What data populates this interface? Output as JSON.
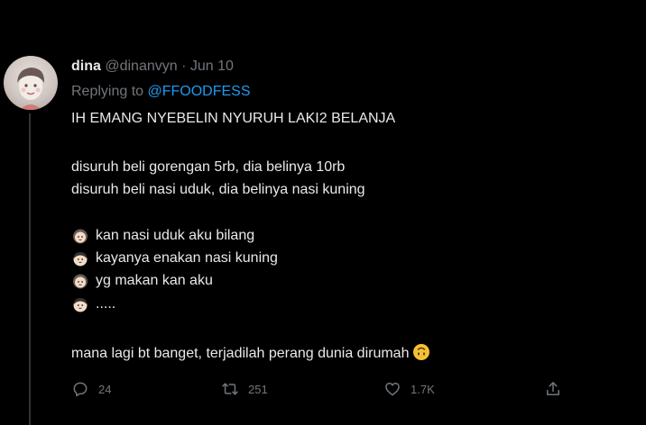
{
  "tweet": {
    "author": {
      "display_name": "dina",
      "handle": "@dinanvyn",
      "separator": "·",
      "date": "Jun 10"
    },
    "replying_to": {
      "prefix": "Replying to",
      "mention": "@FFOODFESS"
    },
    "text": {
      "line1": "IH EMANG NYEBELIN NYURUH LAKI2 BELANJA",
      "line2": "disuruh beli gorengan 5rb, dia belinya 10rb",
      "line3": "disuruh beli nasi uduk, dia belinya nasi kuning",
      "dialog": [
        {
          "speaker": "girl-face-icon",
          "text": "kan nasi uduk aku bilang"
        },
        {
          "speaker": "boy-face-icon",
          "text": "kayanya enakan nasi kuning"
        },
        {
          "speaker": "girl-face-icon",
          "text": "yg makan kan aku"
        },
        {
          "speaker": "boy-face-icon",
          "text": "....."
        }
      ],
      "closing": "mana lagi bt banget, terjadilah perang dunia dirumah",
      "closing_emoji": "upside-down-face-icon"
    },
    "stats": {
      "replies": "24",
      "retweets": "251",
      "likes": "1.7K"
    }
  },
  "colors": {
    "background": "#000000",
    "text_primary": "#e7e9ea",
    "text_secondary": "#71767b",
    "link": "#1d9bf0",
    "divider": "#2f3336",
    "emoji_yellow": "#f7c034"
  }
}
